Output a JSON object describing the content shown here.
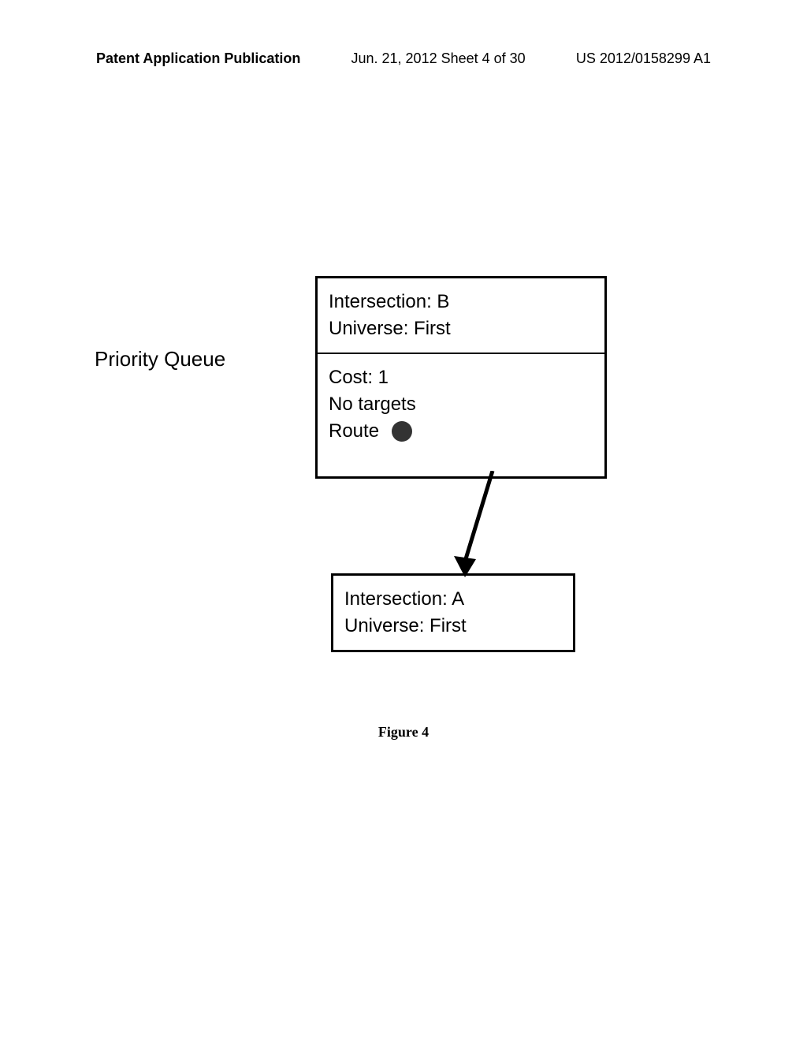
{
  "header": {
    "left": "Patent Application Publication",
    "center": "Jun. 21, 2012  Sheet 4 of 30",
    "right": "US 2012/0158299 A1"
  },
  "diagram": {
    "queue_label": "Priority Queue",
    "box_b": {
      "intersection": "Intersection: B",
      "universe": "Universe: First",
      "cost": "Cost: 1",
      "targets": "No targets",
      "route": "Route"
    },
    "box_a": {
      "intersection": "Intersection: A",
      "universe": "Universe: First"
    }
  },
  "caption": "Figure 4"
}
